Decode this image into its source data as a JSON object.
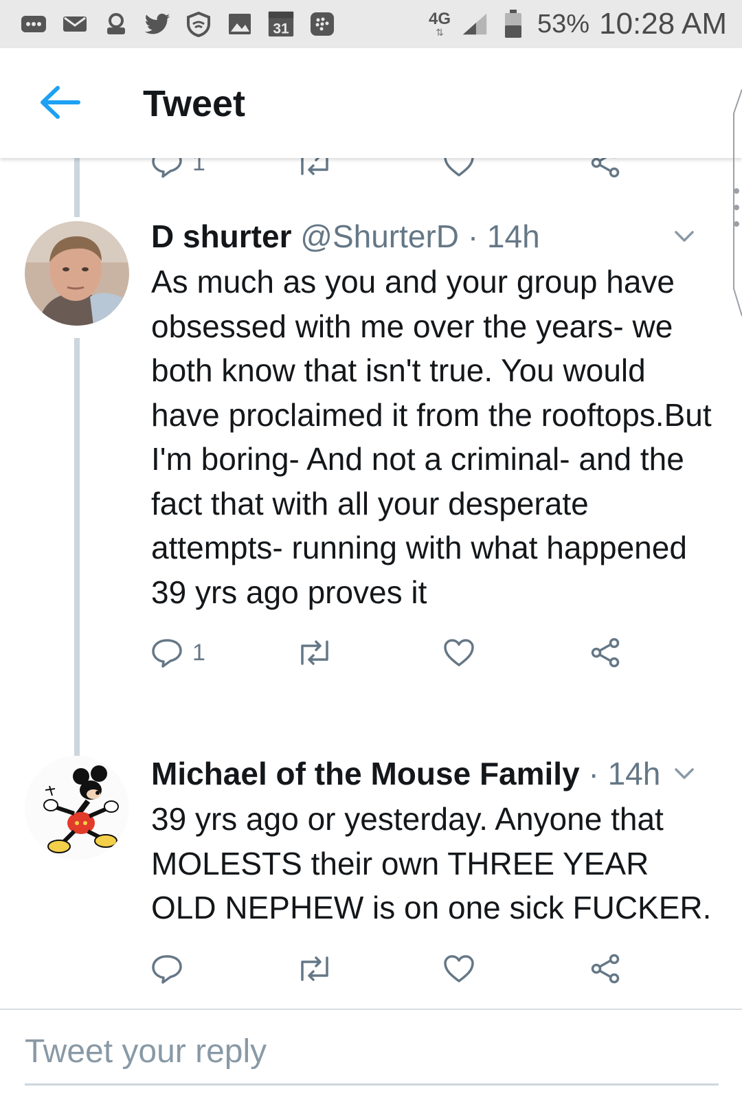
{
  "status_bar": {
    "network": "4G",
    "battery_percent": "53%",
    "time": "10:28 AM",
    "calendar_day": "31",
    "notification_icons": [
      "more-icon",
      "mail-icon",
      "account-icon",
      "twitter-icon",
      "shield-icon",
      "image-icon",
      "calendar-icon",
      "blackberry-icon"
    ]
  },
  "app_bar": {
    "title": "Tweet"
  },
  "colors": {
    "accent": "#1da1f2",
    "text": "#14171a",
    "muted": "#657786",
    "thread_line": "#ccd6dd"
  },
  "top_actions": {
    "reply_count": "1"
  },
  "tweets": [
    {
      "name": "D shurter",
      "handle": "@ShurterD",
      "separator": "·",
      "time": "14h",
      "text": "As much as you and your group have obsessed with me over the years- we both know that isn't true. You would have proclaimed it from the rooftops.But I'm boring- And not a criminal- and the fact that with all your desperate attempts- running with what happened 39 yrs ago proves it",
      "reply_count": "1"
    },
    {
      "name": "Michael of the Mouse Family",
      "handle": "",
      "separator": "·",
      "time": "14h",
      "text": "39 yrs ago or yesterday. Anyone that MOLESTS their own THREE YEAR OLD NEPHEW is on one sick FUCKER.",
      "reply_count": ""
    }
  ],
  "reply_box": {
    "placeholder": "Tweet your reply"
  }
}
